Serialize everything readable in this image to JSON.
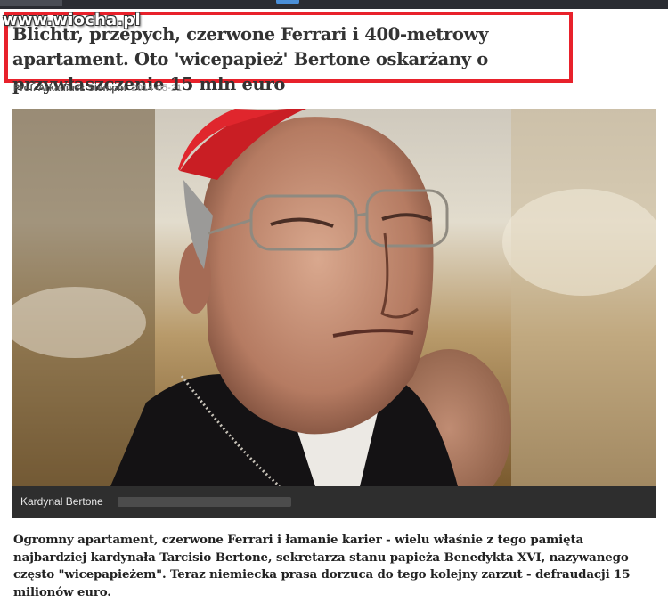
{
  "watermark": "www.wiocha.pl",
  "article": {
    "title": "Blichtr, przepych, czerwone Ferrari i 400-metrowy apartament. Oto 'wicepapież' Bertone oskarżany o przywłaszczenie 15 mln euro",
    "author": "Prof. Arkadiusz Stempin",
    "date": "2014-05-21",
    "image_caption": "Kardynał Bertone",
    "lead": "Ogromny apartament, czerwone Ferrari i łamanie karier - wielu właśnie z tego pamięta najbardziej kardynała Tarcisio Bertone, sekretarza stanu papieża Benedykta XVI, nazywanego często \"wicepapieżem\". Teraz niemiecka prasa dorzuca do tego kolejny zarzut - defraudacji 15 milionów euro."
  },
  "colors": {
    "highlight_border": "#e8212b",
    "caption_bar": "#2e2e2e"
  }
}
